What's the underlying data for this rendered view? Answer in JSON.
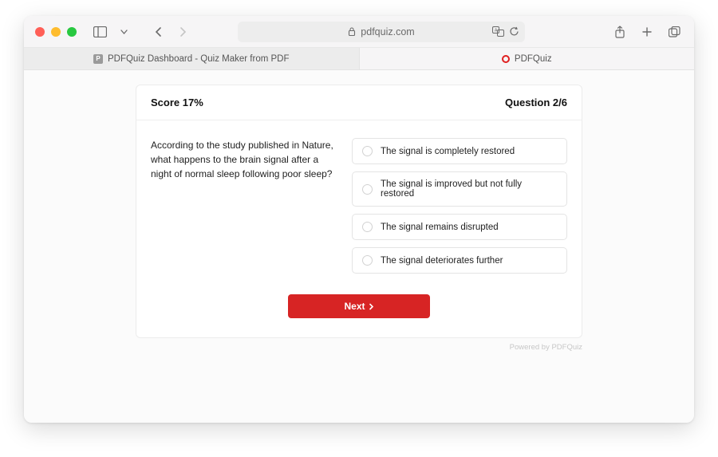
{
  "browser": {
    "url_host": "pdfquiz.com",
    "lock_icon": "lock"
  },
  "tabs": [
    {
      "favicon": "P",
      "label": "PDFQuiz Dashboard - Quiz Maker from PDF"
    },
    {
      "favicon": "O",
      "label": "PDFQuiz"
    }
  ],
  "quiz": {
    "score_label": "Score 17%",
    "progress_label": "Question 2/6",
    "question_text": "According to the study published in Nature, what happens to the brain signal after a night of normal sleep following poor sleep?",
    "options": [
      "The signal is completely restored",
      "The signal is improved but not fully restored",
      "The signal remains disrupted",
      "The signal deteriorates further"
    ],
    "next_label": "Next"
  },
  "footer": {
    "powered_by": "Powered by PDFQuiz"
  }
}
